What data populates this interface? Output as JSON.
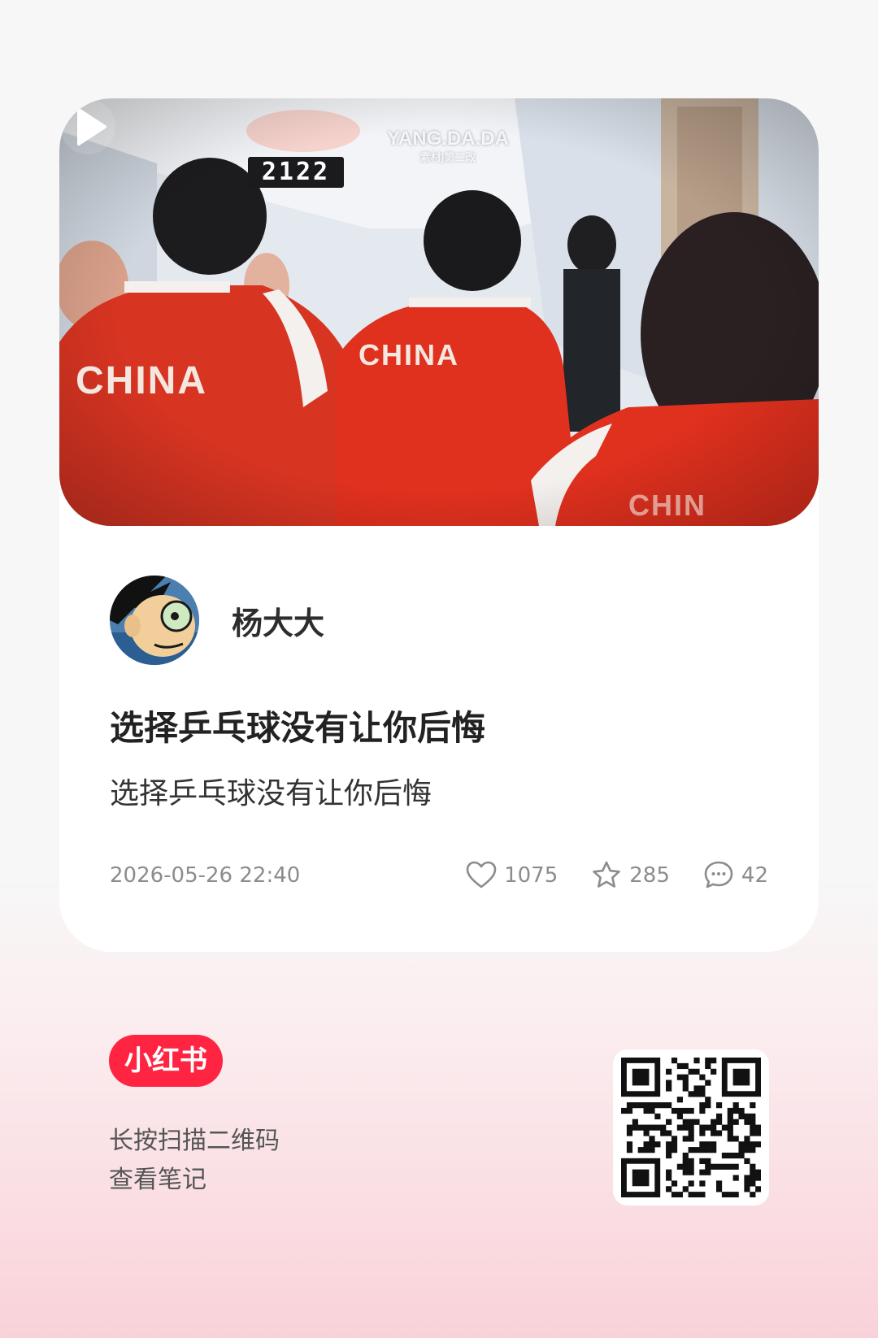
{
  "cover": {
    "watermark": "YANG.DA.DA",
    "watermark_sub": "素材|第二改",
    "scoreboard": "2122",
    "jersey_left": "CHINA",
    "jersey_center": "CHINA",
    "jersey_right": "CHIN"
  },
  "author": {
    "name": "杨大大"
  },
  "note": {
    "title": "选择乒乓球没有让你后悔",
    "description": "选择乒乓球没有让你后悔",
    "date": "2026-05-26 22:40"
  },
  "stats": {
    "likes": "1075",
    "collects": "285",
    "comments": "42"
  },
  "footer": {
    "brand": "小红书",
    "hint_line1": "长按扫描二维码",
    "hint_line2": "查看笔记"
  },
  "icons": {
    "like": "heart-icon",
    "collect": "star-icon",
    "comment": "comment-icon",
    "play": "play-icon"
  },
  "colors": {
    "brand": "#ff2442",
    "jersey_red": "#e0301e"
  }
}
